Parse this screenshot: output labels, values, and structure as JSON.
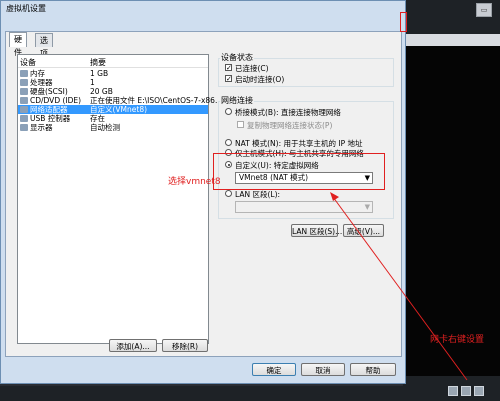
{
  "window": {
    "title": "虚拟机设置"
  },
  "tabs": [
    {
      "label": "硬件"
    },
    {
      "label": "选项"
    }
  ],
  "device_list": {
    "header": {
      "device": "设备",
      "summary": "摘要"
    },
    "rows": [
      {
        "icon": "memory-icon",
        "device": "内存",
        "summary": "1 GB",
        "selected": false
      },
      {
        "icon": "processor-icon",
        "device": "处理器",
        "summary": "1",
        "selected": false
      },
      {
        "icon": "harddisk-icon",
        "device": "硬盘(SCSI)",
        "summary": "20 GB",
        "selected": false
      },
      {
        "icon": "cdrom-icon",
        "device": "CD/DVD (IDE)",
        "summary": "正在使用文件 E:\\ISO\\CentOS-7-x86...",
        "selected": false
      },
      {
        "icon": "network-adapter-icon",
        "device": "网络适配器",
        "summary": "自定义(VMnet8)",
        "selected": true
      },
      {
        "icon": "usb-icon",
        "device": "USB 控制器",
        "summary": "存在",
        "selected": false
      },
      {
        "icon": "display-icon",
        "device": "显示器",
        "summary": "自动检测",
        "selected": false
      }
    ]
  },
  "list_buttons": {
    "add": "添加(A)...",
    "remove": "移除(R)"
  },
  "device_status": {
    "label": "设备状态",
    "connected": {
      "label": "已连接(C)",
      "checked": true
    },
    "connect_at_power_on": {
      "label": "启动时连接(O)",
      "checked": true
    }
  },
  "network_connection": {
    "label": "网络连接",
    "bridged": {
      "label": "桥接模式(B): 直接连接物理网络",
      "checked": false
    },
    "replicate": {
      "label": "复制物理网络连接状态(P)",
      "checked": false
    },
    "nat": {
      "label": "NAT 模式(N): 用于共享主机的 IP 地址",
      "checked": false
    },
    "host_only": {
      "label": "仅主机模式(H): 与主机共享的专用网络",
      "checked": false
    },
    "custom": {
      "label": "自定义(U): 特定虚拟网络",
      "checked": true
    },
    "custom_select_value": "VMnet8 (NAT 模式)",
    "lan_segment": {
      "label": "LAN 区段(L):",
      "checked": false
    },
    "lan_select_value": ""
  },
  "network_buttons": {
    "lan_segments": "LAN 区段(S)...",
    "advanced": "高级(V)..."
  },
  "footer_buttons": {
    "ok": "确定",
    "cancel": "取消",
    "help": "帮助"
  },
  "annotations": {
    "select_vmnet8": "选择vmnet8",
    "nic_right_click": "网卡右键设置"
  },
  "colors": {
    "annotation": "#e02020",
    "selection": "#3399ff",
    "title_bar": "#cfdeef"
  }
}
